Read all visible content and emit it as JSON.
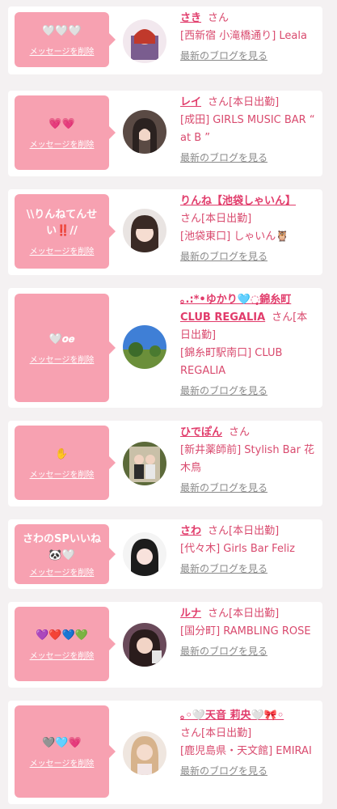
{
  "delete_label": "メッセージを削除",
  "blog_label": "最新のブログを見る",
  "san_label": "さん",
  "accent_color": "#e13c6b",
  "bubble_color": "#f7a1b1",
  "entries": [
    {
      "message": "🤍🤍🤍",
      "name": "さき",
      "honorific": "さん",
      "shop": "[西新宿 小滝橋通り] Leala"
    },
    {
      "message": "💗💗",
      "name": "レイ",
      "honorific": "さん[本日出勤]",
      "shop": "[成田] GIRLS MUSIC BAR “ at B ”"
    },
    {
      "message": "\\\\りんねてんせい‼️//",
      "name": "りんね【池袋しゃいん】",
      "honorific": "さん[本日出勤]",
      "shop": "[池袋東口] しゃいん🦉"
    },
    {
      "message": "🤍𝒐𝒆",
      "name": "｡.:*•ゆかり🩵◌̥錦糸町CLUB REGALIA",
      "honorific": "さん[本日出勤]",
      "shop": "[錦糸町駅南口] CLUB REGALIA"
    },
    {
      "message": "✋",
      "name": "ひでぽん",
      "honorific": "さん",
      "shop": "[新井薬師前] Stylish Bar 花木鳥"
    },
    {
      "message": "さわのSPいいね🐼🤍",
      "name": "さわ",
      "honorific": "さん[本日出勤]",
      "shop": "[代々木] Girls Bar Feliz"
    },
    {
      "message": "💜❤️💙💚",
      "name": "ルナ",
      "honorific": "さん[本日出勤]",
      "shop": "[国分町] RAMBLING ROSE"
    },
    {
      "message": "🩶🩵💗",
      "name": "｡◦🤍天音 莉央🤍🎀◦",
      "honorific": "さん[本日出勤]",
      "shop": "[鹿児島県・天文館] EMIRAI"
    }
  ]
}
